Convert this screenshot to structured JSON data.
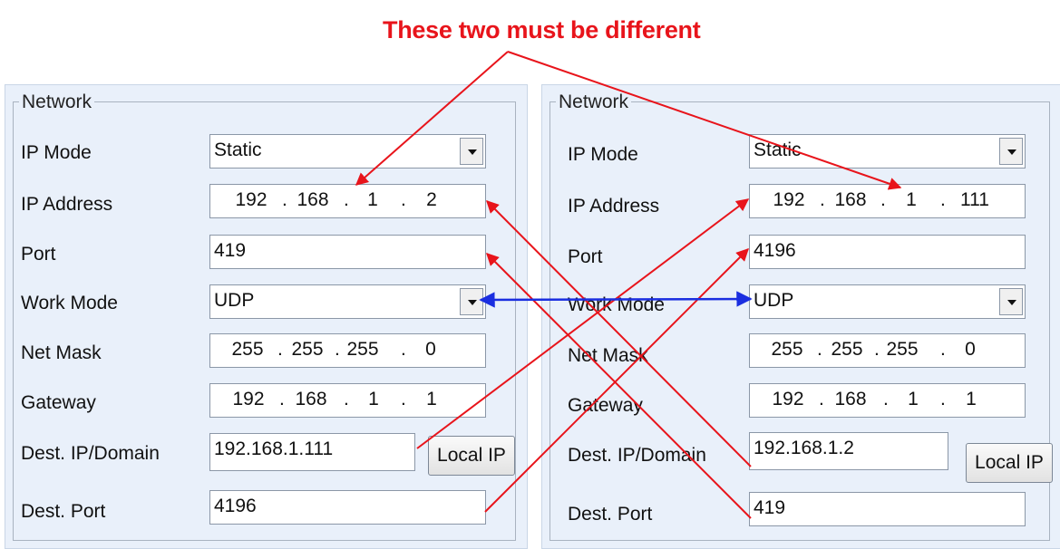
{
  "annotation": {
    "title": "These two must be different",
    "color_red": "#e8141b",
    "color_blue": "#1a2ee0"
  },
  "panels": [
    {
      "legend": "Network",
      "labels": {
        "ip_mode": "IP Mode",
        "ip_address": "IP Address",
        "port": "Port",
        "work_mode": "Work Mode",
        "net_mask": "Net Mask",
        "gateway": "Gateway",
        "dest_ip": "Dest. IP/Domain",
        "dest_port": "Dest. Port"
      },
      "ip_mode": "Static",
      "ip_address": [
        "192",
        "168",
        "1",
        "2"
      ],
      "port": "419",
      "work_mode": "UDP",
      "net_mask": [
        "255",
        "255",
        "255",
        "0"
      ],
      "gateway": [
        "192",
        "168",
        "1",
        "1"
      ],
      "dest_ip": "192.168.1.111",
      "local_ip_button": "Local IP",
      "dest_port": "4196"
    },
    {
      "legend": "Network",
      "labels": {
        "ip_mode": "IP Mode",
        "ip_address": "IP Address",
        "port": "Port",
        "work_mode": "Work Mode",
        "net_mask": "Net Mask",
        "gateway": "Gateway",
        "dest_ip": "Dest. IP/Domain",
        "dest_port": "Dest. Port"
      },
      "ip_mode": "Static",
      "ip_address": [
        "192",
        "168",
        "1",
        "111"
      ],
      "port": "4196",
      "work_mode": "UDP",
      "net_mask": [
        "255",
        "255",
        "255",
        "0"
      ],
      "gateway": [
        "192",
        "168",
        "1",
        "1"
      ],
      "dest_ip": "192.168.1.2",
      "local_ip_button": "Local IP",
      "dest_port": "419"
    }
  ]
}
